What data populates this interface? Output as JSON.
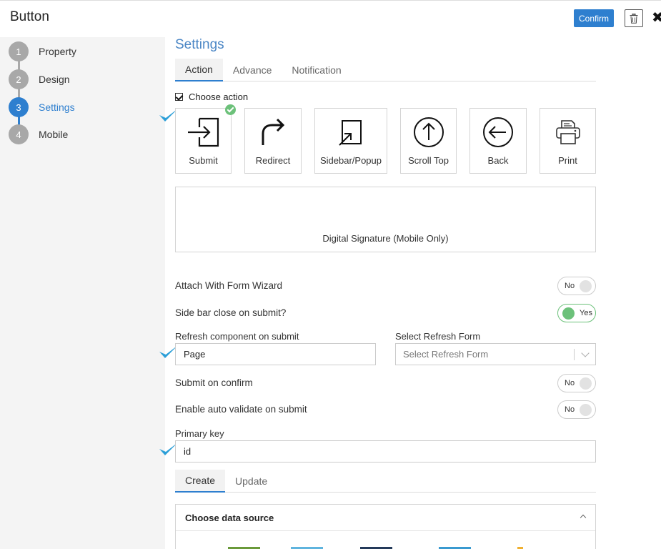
{
  "header": {
    "title": "Button",
    "confirm_label": "Confirm",
    "close_glyph": "✖"
  },
  "steps": [
    {
      "number": "1",
      "label": "Property",
      "state": "done"
    },
    {
      "number": "2",
      "label": "Design",
      "state": "done"
    },
    {
      "number": "3",
      "label": "Settings",
      "state": "active"
    },
    {
      "number": "4",
      "label": "Mobile",
      "state": "pending"
    }
  ],
  "settings": {
    "title": "Settings",
    "tabs": [
      {
        "label": "Action",
        "active": true
      },
      {
        "label": "Advance",
        "active": false
      },
      {
        "label": "Notification",
        "active": false
      }
    ],
    "choose_action_label": "Choose action",
    "actions": [
      {
        "label": "Submit",
        "icon": "submit-icon",
        "selected": true
      },
      {
        "label": "Redirect",
        "icon": "redirect-icon",
        "selected": false
      },
      {
        "label": "Sidebar/Popup",
        "icon": "sidebar-popup-icon",
        "selected": false
      },
      {
        "label": "Scroll Top",
        "icon": "scroll-top-icon",
        "selected": false
      },
      {
        "label": "Back",
        "icon": "back-icon",
        "selected": false
      },
      {
        "label": "Print",
        "icon": "print-icon",
        "selected": false
      }
    ],
    "digital_signature_label": "Digital Signature (Mobile Only)",
    "attach_wizard": {
      "label": "Attach With Form Wizard",
      "value": "No"
    },
    "sidebar_close": {
      "label": "Side bar close on submit?",
      "value": "Yes"
    },
    "refresh_component": {
      "label": "Refresh component on submit",
      "value": "Page"
    },
    "refresh_form": {
      "label": "Select Refresh Form",
      "placeholder": "Select Refresh Form"
    },
    "submit_on_confirm": {
      "label": "Submit on confirm",
      "value": "No"
    },
    "auto_validate": {
      "label": "Enable auto validate on submit",
      "value": "No"
    },
    "primary_key": {
      "label": "Primary key",
      "value": "id"
    },
    "crud_tabs": [
      {
        "label": "Create",
        "active": true
      },
      {
        "label": "Update",
        "active": false
      }
    ],
    "data_source": {
      "title": "Choose data source",
      "swatches": [
        "#6a9a3a",
        "#5fb4de",
        "#243a5a",
        "#3a9ad0",
        "#f0b030"
      ]
    }
  },
  "colors": {
    "accent": "#2e7fcf",
    "title_blue": "#4a86c5",
    "toggle_on": "#6cc17a",
    "pointer_check": "#2c9fd8"
  }
}
